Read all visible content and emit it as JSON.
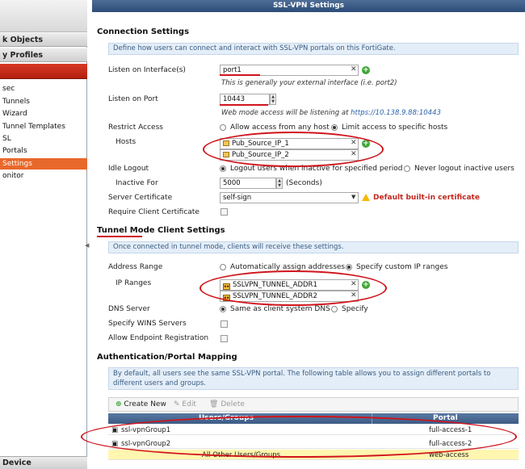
{
  "sidebar": {
    "sections": [
      "k Objects",
      "y Profiles"
    ],
    "items": [
      "sec",
      "Tunnels",
      "Wizard",
      "Tunnel Templates",
      "SL",
      "Portals",
      "Settings",
      "onitor"
    ],
    "selected_index": 6,
    "bottom": "Device"
  },
  "window": {
    "title": "SSL-VPN Settings"
  },
  "connection": {
    "heading": "Connection Settings",
    "info": "Define how users can connect and interact with SSL-VPN portals on this FortiGate.",
    "listen_interface_label": "Listen on Interface(s)",
    "listen_interface_value": "port1",
    "listen_interface_hint": "This is generally your external interface (i.e. port2)",
    "listen_port_label": "Listen on Port",
    "listen_port_value": "10443",
    "listen_port_hint": "Web mode access will be listening at",
    "listen_port_url": "https://10.138.9.88:10443",
    "restrict_label": "Restrict Access",
    "restrict_opt1": "Allow access from any host",
    "restrict_opt2": "Limit access to specific hosts",
    "hosts_label": "Hosts",
    "hosts": [
      "Pub_Source_IP_1",
      "Pub_Source_IP_2"
    ],
    "idle_label": "Idle Logout",
    "idle_opt1": "Logout users when inactive for specified period",
    "idle_opt2": "Never logout inactive users",
    "inactive_label": "Inactive For",
    "inactive_value": "5000",
    "inactive_unit": "(Seconds)",
    "cert_label": "Server Certificate",
    "cert_value": "self-sign",
    "cert_warning": "Default built-in certificate",
    "client_cert_label": "Require Client Certificate"
  },
  "tunnel": {
    "heading": "Tunnel Mode Client Settings",
    "info": "Once connected in tunnel mode, clients will receive these settings.",
    "address_label": "Address Range",
    "address_opt1": "Automatically assign addresses",
    "address_opt2": "Specify custom IP ranges",
    "ip_ranges_label": "IP Ranges",
    "ip_ranges": [
      "SSLVPN_TUNNEL_ADDR1",
      "SSLVPN_TUNNEL_ADDR2"
    ],
    "dns_label": "DNS Server",
    "dns_opt1": "Same as client system DNS",
    "dns_opt2": "Specify",
    "wins_label": "Specify WINS Servers",
    "endpoint_label": "Allow Endpoint Registration"
  },
  "auth": {
    "heading": "Authentication/Portal Mapping",
    "info": "By default, all users see the same SSL-VPN portal. The following table allows you to assign different portals to different users and groups.",
    "toolbar": {
      "create": "Create New",
      "edit": "Edit",
      "delete": "Delete"
    },
    "columns": [
      "Users/Groups",
      "Portal"
    ],
    "rows": [
      {
        "group": "ssl-vpnGroup1",
        "portal": "full-access-1"
      },
      {
        "group": "ssl-vpnGroup2",
        "portal": "full-access-2"
      },
      {
        "group": "All Other Users/Groups",
        "portal": "web-access"
      }
    ]
  },
  "colors": {
    "annotation_red": "#d0141b",
    "selected_orange": "#e8682a",
    "header_blue": "#3c5b85"
  }
}
